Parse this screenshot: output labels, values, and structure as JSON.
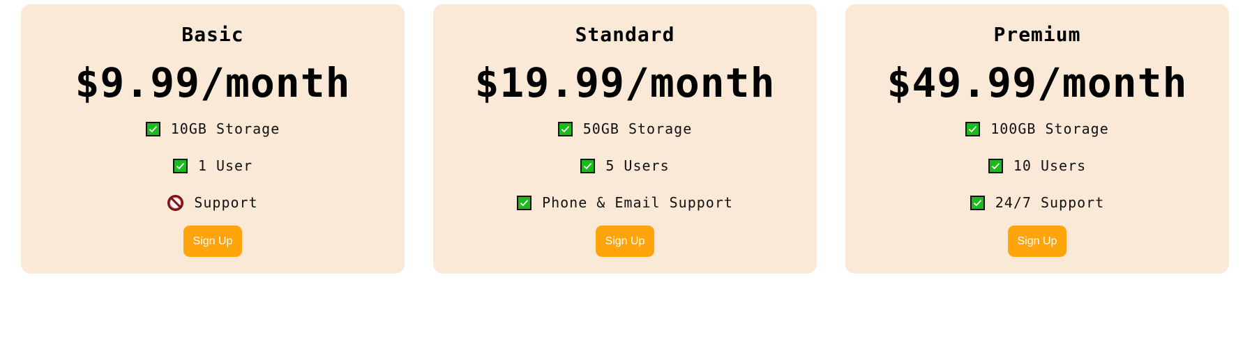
{
  "plans": [
    {
      "name": "Basic",
      "price": "$9.99/month",
      "features": [
        {
          "text": "10GB Storage",
          "icon": "check-icon",
          "included": true
        },
        {
          "text": "1 User",
          "icon": "check-icon",
          "included": true
        },
        {
          "text": "Support",
          "icon": "prohibited-icon",
          "included": false
        }
      ],
      "button_label": "Sign Up"
    },
    {
      "name": "Standard",
      "price": "$19.99/month",
      "features": [
        {
          "text": "50GB Storage",
          "icon": "check-icon",
          "included": true
        },
        {
          "text": "5 Users",
          "icon": "check-icon",
          "included": true
        },
        {
          "text": "Phone & Email Support",
          "icon": "check-icon",
          "included": true
        }
      ],
      "button_label": "Sign Up"
    },
    {
      "name": "Premium",
      "price": "$49.99/month",
      "features": [
        {
          "text": "100GB Storage",
          "icon": "check-icon",
          "included": true
        },
        {
          "text": "10 Users",
          "icon": "check-icon",
          "included": true
        },
        {
          "text": "24/7 Support",
          "icon": "check-icon",
          "included": true
        }
      ],
      "button_label": "Sign Up"
    }
  ],
  "colors": {
    "card_background": "#f9e9d6",
    "button_background": "#ffa40b",
    "button_text": "#ffffff",
    "check_green": "#1cbb1c",
    "prohibited_red": "#7a1414"
  }
}
